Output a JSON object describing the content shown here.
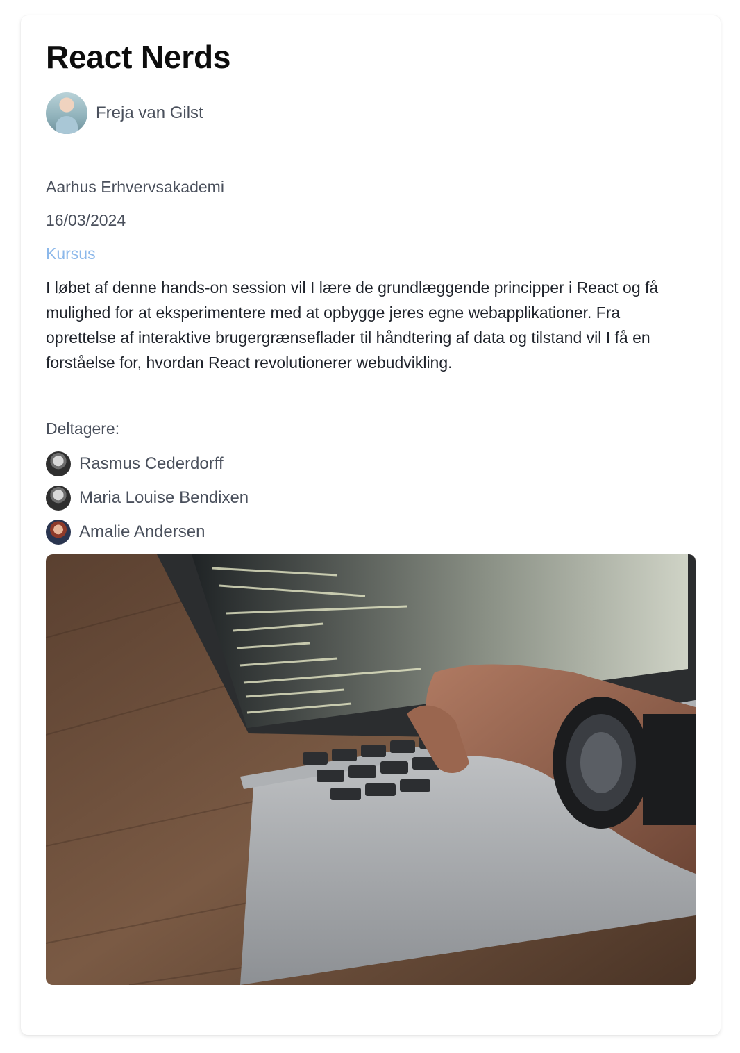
{
  "event": {
    "title": "React Nerds",
    "author": "Freja van Gilst",
    "organization": "Aarhus Erhvervsakademi",
    "date": "16/03/2024",
    "category": "Kursus",
    "description": "I løbet af denne hands-on session vil I lære de grundlæggende principper i React og få mulighed for at eksperimentere med at opbygge jeres egne webapplikationer. Fra oprettelse af interaktive brugergrænseflader til håndtering af data og tilstand vil I få en forståelse for, hvordan React revolutionerer webudvikling.",
    "participants_label": "Deltagere:",
    "participants": [
      {
        "name": "Rasmus Cederdorff"
      },
      {
        "name": "Maria Louise Bendixen"
      },
      {
        "name": "Amalie Andersen"
      }
    ]
  },
  "colors": {
    "category": "#8cb8ea",
    "text": "#4a505c",
    "heading": "#0d0d0d"
  }
}
